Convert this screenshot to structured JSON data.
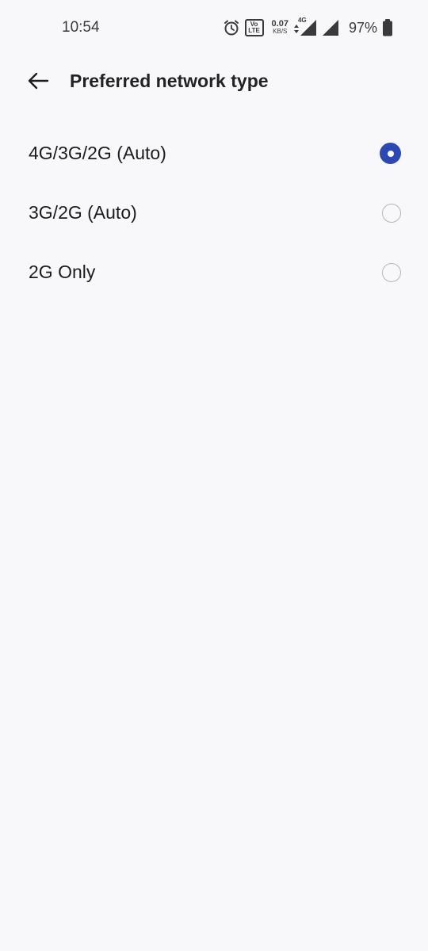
{
  "status_bar": {
    "time": "10:54",
    "volte_top": "Vo",
    "volte_bottom": "LTE",
    "net_speed_value": "0.07",
    "net_speed_unit": "KB/S",
    "network_gen": "4G",
    "battery_percent": "97%",
    "icons": [
      "alarm-icon",
      "volte-icon",
      "data-arrows-icon",
      "signal-icon",
      "signal-icon",
      "battery-icon"
    ]
  },
  "header": {
    "back_icon": "arrow-left-icon",
    "title": "Preferred network type"
  },
  "options": [
    {
      "label": "4G/3G/2G (Auto)",
      "selected": true
    },
    {
      "label": "3G/2G (Auto)",
      "selected": false
    },
    {
      "label": "2G Only",
      "selected": false
    }
  ],
  "colors": {
    "accent": "#2b49b5",
    "background": "#f8f8fa",
    "text": "#1c1c1e"
  }
}
